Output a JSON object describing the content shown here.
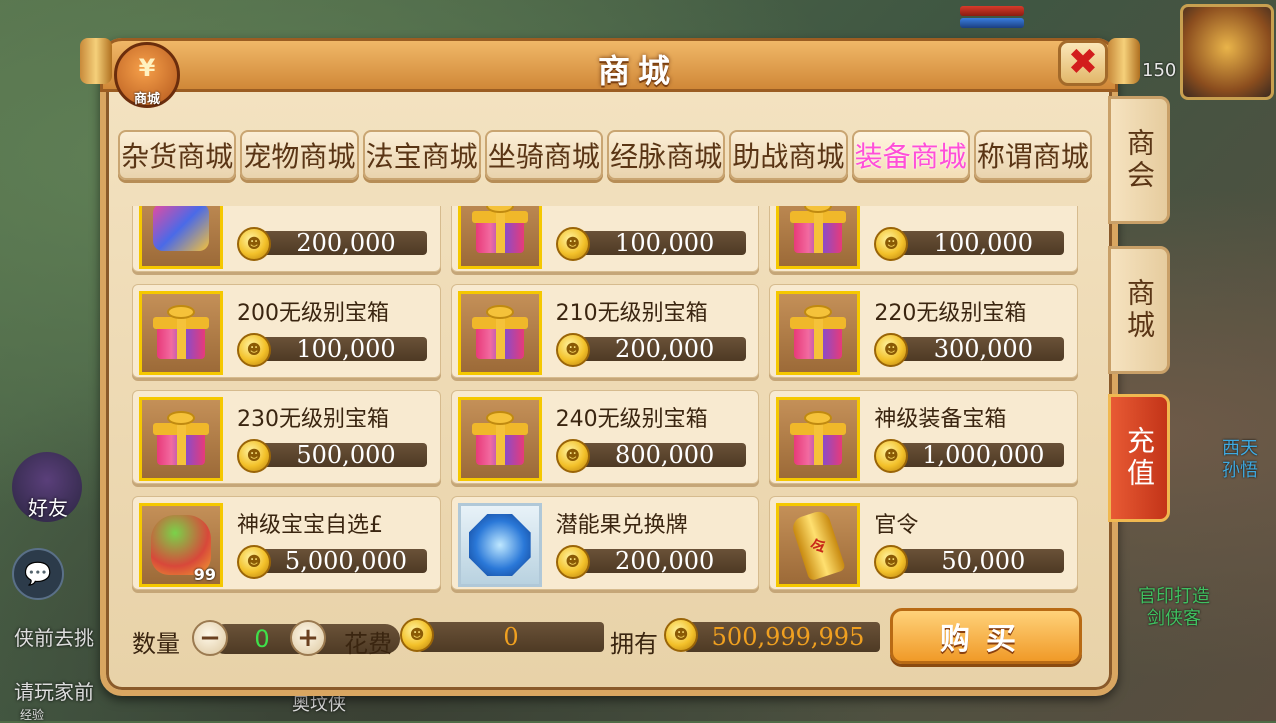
{
  "background": {
    "left_texts": [
      "侠前去挑",
      "请玩家前",
      "经验"
    ],
    "friend_label": "好友",
    "chat_icon": "chat-bubble-icon",
    "level_value": "150",
    "npc_top": [
      "西天",
      "孙悟"
    ],
    "npc_bottom": [
      "官印打造",
      "剑侠客"
    ],
    "bottom_text": "奥坟侠"
  },
  "window": {
    "title": "商城",
    "badge_label": "商城",
    "close_icon": "close-x-icon"
  },
  "tabs": [
    {
      "label": "杂货商城",
      "active": false
    },
    {
      "label": "宠物商城",
      "active": false
    },
    {
      "label": "法宝商城",
      "active": false
    },
    {
      "label": "坐骑商城",
      "active": false
    },
    {
      "label": "经脉商城",
      "active": false
    },
    {
      "label": "助战商城",
      "active": false
    },
    {
      "label": "装备商城",
      "active": true
    },
    {
      "label": "称谓商城",
      "active": false
    }
  ],
  "items": [
    {
      "name": "",
      "price": "200,000",
      "icon": "decorated-chest-icon"
    },
    {
      "name": "",
      "price": "100,000",
      "icon": "gift-box-icon"
    },
    {
      "name": "",
      "price": "100,000",
      "icon": "gift-box-icon"
    },
    {
      "name": "200无级别宝箱",
      "price": "100,000",
      "icon": "gift-box-icon"
    },
    {
      "name": "210无级别宝箱",
      "price": "200,000",
      "icon": "gift-box-icon"
    },
    {
      "name": "220无级别宝箱",
      "price": "300,000",
      "icon": "gift-box-icon"
    },
    {
      "name": "230无级别宝箱",
      "price": "500,000",
      "icon": "gift-box-icon"
    },
    {
      "name": "240无级别宝箱",
      "price": "800,000",
      "icon": "gift-box-icon"
    },
    {
      "name": "神级装备宝箱",
      "price": "1,000,000",
      "icon": "gift-box-icon"
    },
    {
      "name": "神级宝宝自选£",
      "price": "5,000,000",
      "icon": "pet-bundle-icon",
      "stack": "99"
    },
    {
      "name": "潜能果兑换牌",
      "price": "200,000",
      "icon": "blue-gem-token-icon"
    },
    {
      "name": "官令",
      "price": "50,000",
      "icon": "golden-token-icon"
    }
  ],
  "footer": {
    "qty_label": "数量",
    "qty_value": "0",
    "cost_label": "花费",
    "cost_value": "0",
    "own_label": "拥有",
    "own_value": "500,999,995",
    "buy_label": "购买"
  },
  "side_tabs": [
    "商会",
    "商城",
    "充值"
  ],
  "colors": {
    "active_tab": "#ff4fd8",
    "qty": "#3fe04a",
    "amount": "#f0a020"
  }
}
